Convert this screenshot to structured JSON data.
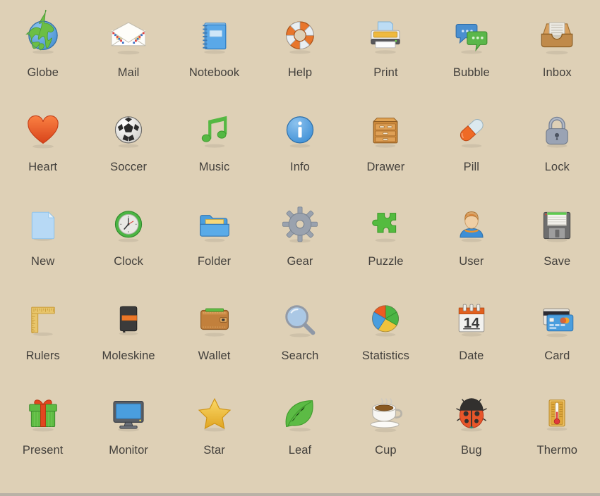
{
  "board": {
    "background_color": "#ded0b6",
    "label_color": "#423f3b",
    "bottom_border_color": "#b9b2a6",
    "columns": 7,
    "rows": 5
  },
  "icons": [
    {
      "label": "Globe",
      "icon": "globe-icon",
      "colors": {
        "primary": "#4a92d4",
        "secondary": "#6cbe45"
      }
    },
    {
      "label": "Mail",
      "icon": "mail-icon",
      "colors": {
        "primary": "#f5f2ea",
        "secondary": "#f2d98b"
      }
    },
    {
      "label": "Notebook",
      "icon": "notebook-icon",
      "colors": {
        "primary": "#5aa8e8",
        "secondary": "#2f7cc2"
      }
    },
    {
      "label": "Help",
      "icon": "lifebuoy-icon",
      "colors": {
        "primary": "#e8762c",
        "secondary": "#e9eef2"
      }
    },
    {
      "label": "Print",
      "icon": "printer-icon",
      "colors": {
        "primary": "#efefef",
        "secondary": "#efb93f"
      }
    },
    {
      "label": "Bubble",
      "icon": "speech-bubble-icon",
      "colors": {
        "primary": "#4a8fd0",
        "secondary": "#5bb74a"
      }
    },
    {
      "label": "Inbox",
      "icon": "inbox-tray-icon",
      "colors": {
        "primary": "#c08a4a",
        "secondary": "#eceae3"
      }
    },
    {
      "label": "Heart",
      "icon": "heart-icon",
      "colors": {
        "primary": "#ef5f22",
        "secondary": "#d8431a"
      }
    },
    {
      "label": "Soccer",
      "icon": "soccer-ball-icon",
      "colors": {
        "primary": "#f2f1ee",
        "secondary": "#2b2b2b"
      }
    },
    {
      "label": "Music",
      "icon": "music-note-icon",
      "colors": {
        "primary": "#55b843",
        "secondary": "#3d9a2e"
      }
    },
    {
      "label": "Info",
      "icon": "info-circle-icon",
      "colors": {
        "primary": "#3d8fd6",
        "secondary": "#ffffff"
      }
    },
    {
      "label": "Drawer",
      "icon": "drawer-cabinet-icon",
      "colors": {
        "primary": "#cc8a3c",
        "secondary": "#a5692a"
      }
    },
    {
      "label": "Pill",
      "icon": "pill-capsule-icon",
      "colors": {
        "primary": "#ef6a26",
        "secondary": "#dbe9ef"
      }
    },
    {
      "label": "Lock",
      "icon": "padlock-icon",
      "colors": {
        "primary": "#9aa3b4",
        "secondary": "#7a8496"
      }
    },
    {
      "label": "New",
      "icon": "new-document-icon",
      "colors": {
        "primary": "#b7d9f5",
        "secondary": "#8ec2ea"
      }
    },
    {
      "label": "Clock",
      "icon": "clock-icon",
      "colors": {
        "primary": "#4cb544",
        "secondary": "#e9e8e4"
      }
    },
    {
      "label": "Folder",
      "icon": "open-folder-icon",
      "colors": {
        "primary": "#4a9ede",
        "secondary": "#f6d77a"
      }
    },
    {
      "label": "Gear",
      "icon": "gear-icon",
      "colors": {
        "primary": "#9aa2ae",
        "secondary": "#7d8794"
      }
    },
    {
      "label": "Puzzle",
      "icon": "puzzle-piece-icon",
      "colors": {
        "primary": "#54bb3f",
        "secondary": "#3f9c2c"
      }
    },
    {
      "label": "User",
      "icon": "user-avatar-icon",
      "colors": {
        "primary": "#3d8fd6",
        "secondary": "#d8a56a"
      }
    },
    {
      "label": "Save",
      "icon": "floppy-disk-icon",
      "colors": {
        "primary": "#6e6e6e",
        "secondary": "#5fcb4f"
      }
    },
    {
      "label": "Rulers",
      "icon": "ruler-icon",
      "colors": {
        "primary": "#e8c56b",
        "secondary": "#c79a36"
      }
    },
    {
      "label": "Moleskine",
      "icon": "moleskine-notebook-icon",
      "colors": {
        "primary": "#3b3b3b",
        "secondary": "#ec7728"
      }
    },
    {
      "label": "Wallet",
      "icon": "wallet-icon",
      "colors": {
        "primary": "#c2803c",
        "secondary": "#8e5a25"
      }
    },
    {
      "label": "Search",
      "icon": "magnifier-icon",
      "colors": {
        "primary": "#a9c8e8",
        "secondary": "#8f98a6"
      }
    },
    {
      "label": "Statistics",
      "icon": "pie-chart-icon",
      "colors": {
        "primary": "#4a9ede",
        "secondary": "#4cb544"
      }
    },
    {
      "label": "Date",
      "icon": "calendar-icon",
      "colors": {
        "primary": "#e2601f",
        "secondary": "#f2f1ee"
      },
      "day": "14"
    },
    {
      "label": "Card",
      "icon": "credit-card-icon",
      "colors": {
        "primary": "#4a9ede",
        "secondary": "#2b2b33"
      }
    },
    {
      "label": "Present",
      "icon": "gift-box-icon",
      "colors": {
        "primary": "#5fbb43",
        "secondary": "#e2461f"
      }
    },
    {
      "label": "Monitor",
      "icon": "monitor-icon",
      "colors": {
        "primary": "#4a9ede",
        "secondary": "#5a5f66"
      }
    },
    {
      "label": "Star",
      "icon": "star-icon",
      "colors": {
        "primary": "#f5c33b",
        "secondary": "#e0a522"
      }
    },
    {
      "label": "Leaf",
      "icon": "leaf-icon",
      "colors": {
        "primary": "#5cbb45",
        "secondary": "#3f9c2c"
      }
    },
    {
      "label": "Cup",
      "icon": "coffee-cup-icon",
      "colors": {
        "primary": "#f7f6f3",
        "secondary": "#8a5a22"
      }
    },
    {
      "label": "Bug",
      "icon": "ladybug-icon",
      "colors": {
        "primary": "#e8562a",
        "secondary": "#32302e"
      }
    },
    {
      "label": "Thermo",
      "icon": "thermometer-icon",
      "colors": {
        "primary": "#e0a93c",
        "secondary": "#e03a3a"
      }
    }
  ]
}
